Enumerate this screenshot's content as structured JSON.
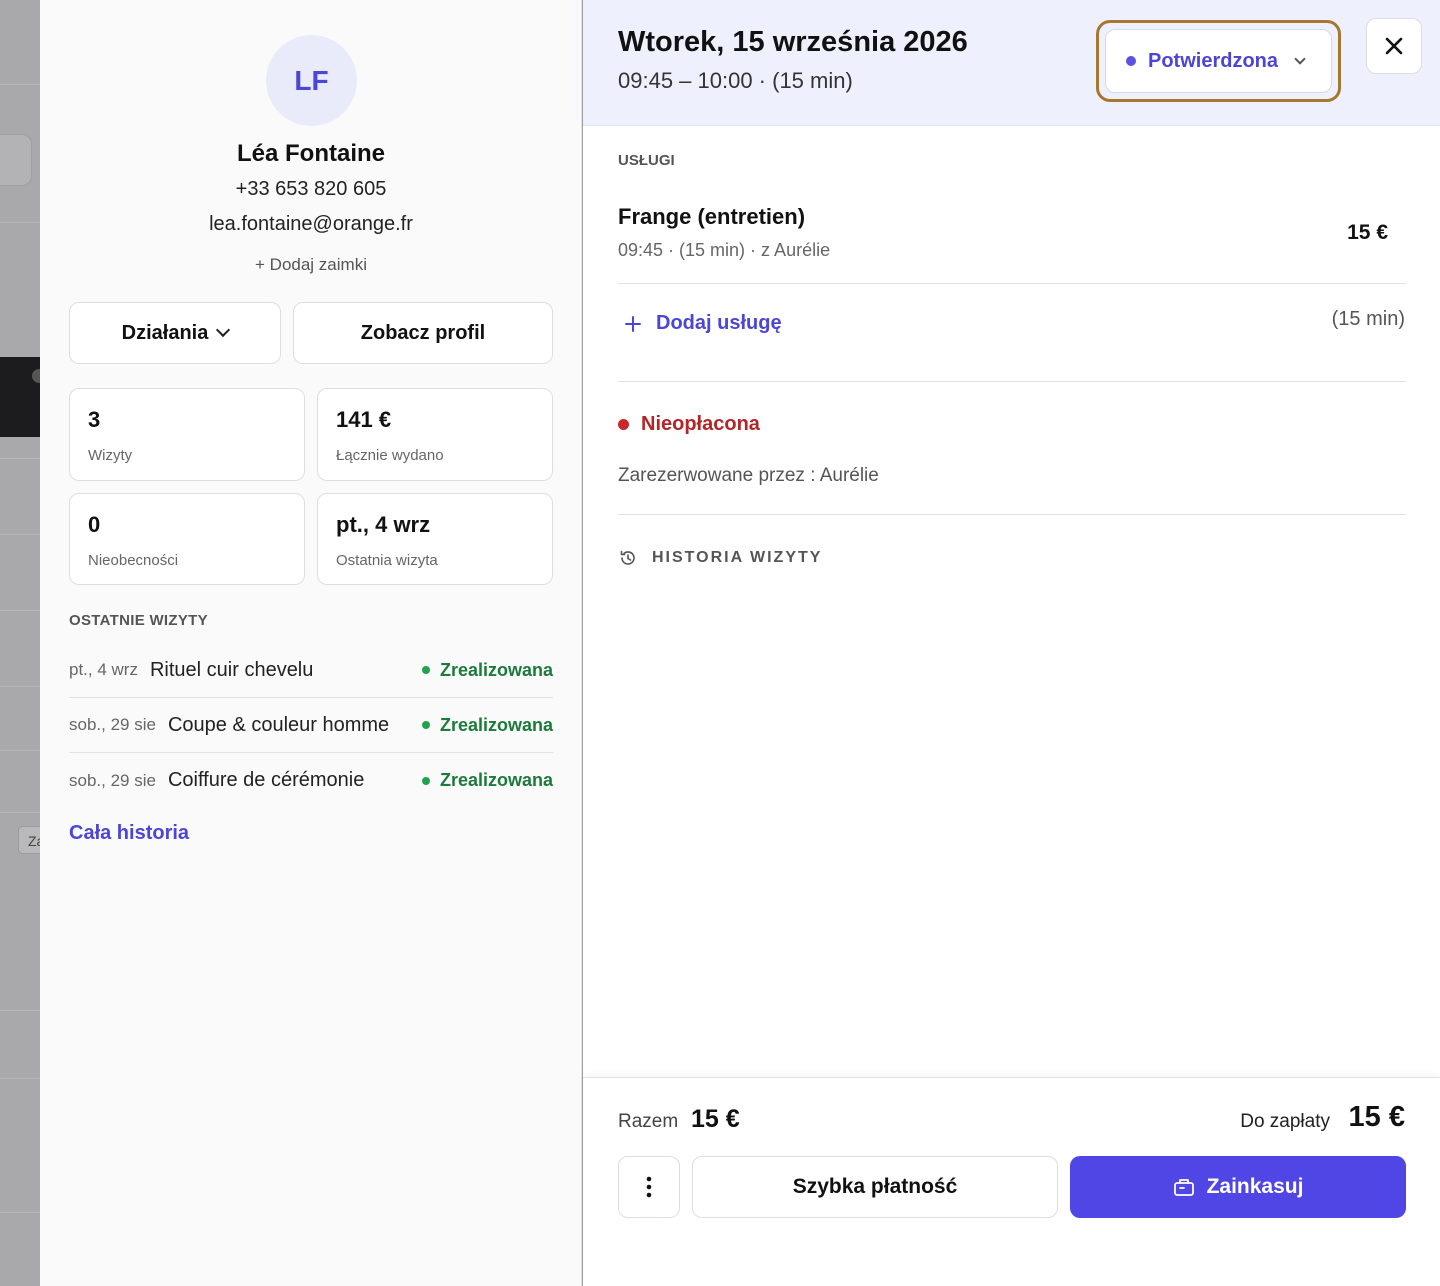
{
  "client": {
    "initials": "LF",
    "name": "Léa Fontaine",
    "phone": "+33 653 820 605",
    "email": "lea.fontaine@orange.fr",
    "add_pronouns": "+ Dodaj zaimki",
    "actions_label": "Działania",
    "profile_label": "Zobacz profil",
    "stats": [
      {
        "value": "3",
        "label": "Wizyty"
      },
      {
        "value": "141 €",
        "label": "Łącznie wydano"
      },
      {
        "value": "0",
        "label": "Nieobecności"
      },
      {
        "value": "pt., 4 wrz",
        "label": "Ostatnia wizyta"
      }
    ],
    "recent_title": "OSTATNIE WIZYTY",
    "recent_visits": [
      {
        "date": "pt., 4 wrz",
        "service": "Rituel cuir chevelu",
        "status": "Zrealizowana"
      },
      {
        "date": "sob., 29 sie",
        "service": "Coupe & couleur homme",
        "status": "Zrealizowana"
      },
      {
        "date": "sob., 29 sie",
        "service": "Coiffure de cérémonie",
        "status": "Zrealizowana"
      }
    ],
    "full_history": "Cała historia"
  },
  "appointment": {
    "date": "Wtorek, 15 września 2026",
    "time": "09:45 – 10:00 · (15 min)",
    "status": "Potwierdzona",
    "services_label": "USŁUGI",
    "service": {
      "name": "Frange (entretien)",
      "meta": "09:45 · (15 min) · z Aurélie",
      "price": "15 €"
    },
    "add_service": "Dodaj usługę",
    "total_duration": "(15 min)",
    "payment_status": "Nieopłacona",
    "booked_by": "Zarezerwowane przez : Aurélie",
    "history_label": "HISTORIA WIZYTY"
  },
  "footer": {
    "total_label": "Razem",
    "total_value": "15 €",
    "due_label": "Do zapłaty",
    "due_value": "15 €",
    "quick_pay": "Szybka płatność",
    "checkout": "Zainkasuj"
  },
  "backdrop": {
    "tag": "Za"
  },
  "colors": {
    "accent": "#4f46e5",
    "success": "#1c7a3a",
    "danger": "#b32527",
    "highlight_border": "#a5772f"
  }
}
